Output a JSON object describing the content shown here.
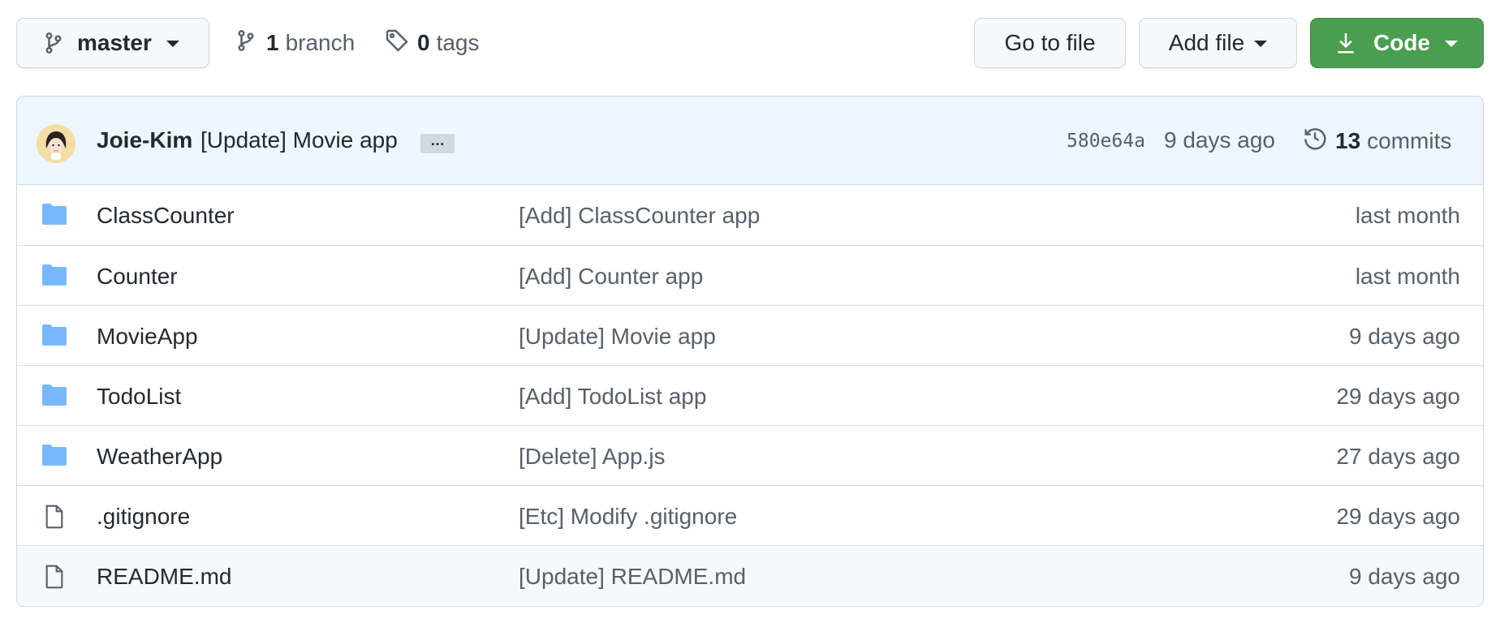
{
  "toolbar": {
    "branch": "master",
    "branch_count": "1",
    "branch_label": "branch",
    "tag_count": "0",
    "tag_label": "tags",
    "go_to_file": "Go to file",
    "add_file": "Add file",
    "code": "Code"
  },
  "commit": {
    "author": "Joie-Kim",
    "message": "[Update] Movie app",
    "ellipsis": "…",
    "sha": "580e64a",
    "time": "9 days ago",
    "commit_count": "13",
    "commit_label": "commits"
  },
  "files": [
    {
      "type": "folder",
      "name": "ClassCounter",
      "message": "[Add] ClassCounter app",
      "age": "last month"
    },
    {
      "type": "folder",
      "name": "Counter",
      "message": "[Add] Counter app",
      "age": "last month"
    },
    {
      "type": "folder",
      "name": "MovieApp",
      "message": "[Update] Movie app",
      "age": "9 days ago"
    },
    {
      "type": "folder",
      "name": "TodoList",
      "message": "[Add] TodoList app",
      "age": "29 days ago"
    },
    {
      "type": "folder",
      "name": "WeatherApp",
      "message": "[Delete] App.js",
      "age": "27 days ago"
    },
    {
      "type": "file",
      "name": ".gitignore",
      "message": "[Etc] Modify .gitignore",
      "age": "29 days ago"
    },
    {
      "type": "file",
      "name": "README.md",
      "message": "[Update] README.md",
      "age": "9 days ago"
    }
  ],
  "colors": {
    "code_button": "#4a9e4f",
    "folder_icon": "#79b8ff",
    "commit_bar": "#eef6ff"
  },
  "icons": {
    "branch": "git-branch-icon",
    "tag": "tag-icon",
    "download": "download-icon",
    "history": "history-icon",
    "folder": "folder-icon",
    "file": "file-icon"
  }
}
